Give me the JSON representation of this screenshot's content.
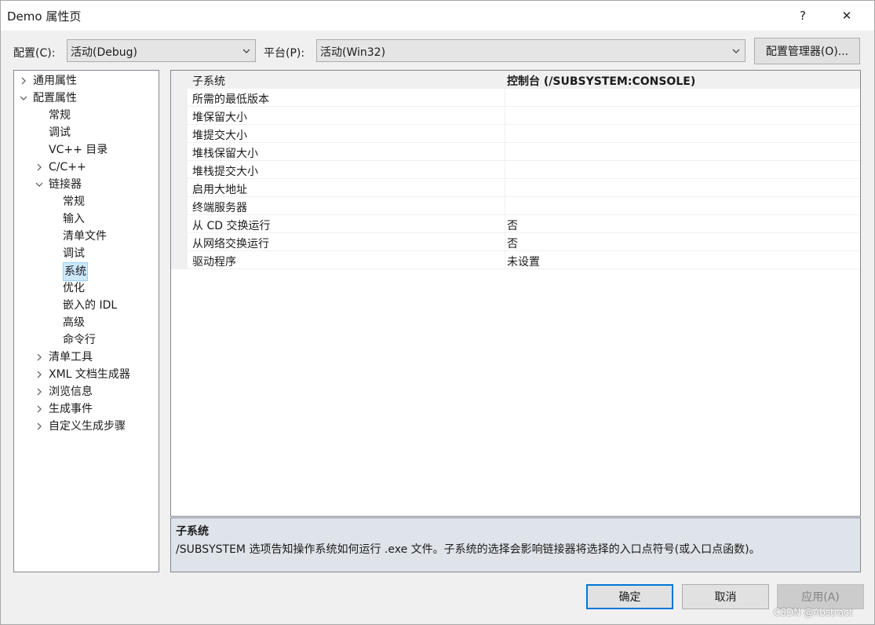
{
  "window": {
    "title": "Demo 属性页",
    "help_glyph": "?",
    "close_glyph": "✕"
  },
  "config": {
    "config_label": "配置(C):",
    "config_value": "活动(Debug)",
    "platform_label": "平台(P):",
    "platform_value": "活动(Win32)",
    "manager_button": "配置管理器(O)..."
  },
  "tree": [
    {
      "label": "通用属性",
      "expander": "collapsed"
    },
    {
      "label": "配置属性",
      "expander": "expanded"
    },
    {
      "label": "常规",
      "expander": "none"
    },
    {
      "label": "调试",
      "expander": "none"
    },
    {
      "label": "VC++ 目录",
      "expander": "none"
    },
    {
      "label": "C/C++",
      "expander": "collapsed"
    },
    {
      "label": "链接器",
      "expander": "expanded"
    },
    {
      "label": "常规",
      "expander": "none"
    },
    {
      "label": "输入",
      "expander": "none"
    },
    {
      "label": "清单文件",
      "expander": "none"
    },
    {
      "label": "调试",
      "expander": "none"
    },
    {
      "label": "系统",
      "expander": "none",
      "selected": true
    },
    {
      "label": "优化",
      "expander": "none"
    },
    {
      "label": "嵌入的 IDL",
      "expander": "none"
    },
    {
      "label": "高级",
      "expander": "none"
    },
    {
      "label": "命令行",
      "expander": "none"
    },
    {
      "label": "清单工具",
      "expander": "collapsed"
    },
    {
      "label": "XML 文档生成器",
      "expander": "collapsed"
    },
    {
      "label": "浏览信息",
      "expander": "collapsed"
    },
    {
      "label": "生成事件",
      "expander": "collapsed"
    },
    {
      "label": "自定义生成步骤",
      "expander": "collapsed"
    }
  ],
  "properties": [
    {
      "name": "子系统",
      "value": "控制台 (/SUBSYSTEM:CONSOLE)"
    },
    {
      "name": "所需的最低版本",
      "value": ""
    },
    {
      "name": "堆保留大小",
      "value": ""
    },
    {
      "name": "堆提交大小",
      "value": ""
    },
    {
      "name": "堆栈保留大小",
      "value": ""
    },
    {
      "name": "堆栈提交大小",
      "value": ""
    },
    {
      "name": "启用大地址",
      "value": ""
    },
    {
      "name": "终端服务器",
      "value": ""
    },
    {
      "name": "从 CD 交换运行",
      "value": "否"
    },
    {
      "name": "从网络交换运行",
      "value": "否"
    },
    {
      "name": "驱动程序",
      "value": "未设置"
    }
  ],
  "description": {
    "title": "子系统",
    "text": "/SUBSYSTEM 选项告知操作系统如何运行 .exe 文件。子系统的选择会影响链接器将选择的入口点符号(或入口点函数)。"
  },
  "buttons": {
    "ok": "确定",
    "cancel": "取消",
    "apply": "应用(A)"
  },
  "watermark": "CSDN @Abstract"
}
